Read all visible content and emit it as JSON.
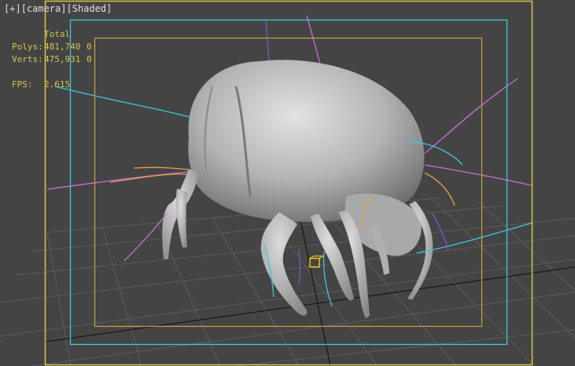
{
  "viewport": {
    "label_plus": "[+]",
    "label_camera": "[camera]",
    "label_mode": "[Shaded]"
  },
  "stats": {
    "header": "Total",
    "polys_label": "Polys:",
    "polys_total": "481,740",
    "polys_selected": "0",
    "verts_label": "Verts:",
    "verts_total": "475,931",
    "verts_selected": "0",
    "fps_label": "FPS:",
    "fps_value": "2.615"
  },
  "colors": {
    "background": "#444444",
    "grid": "#5e5e5e",
    "safe_frame_outer": "#d8c24a",
    "safe_frame_action": "#3fc6e0",
    "safe_frame_title": "#c9a43c",
    "stats_text": "#d8c24a",
    "model": "#bdbdbd"
  }
}
